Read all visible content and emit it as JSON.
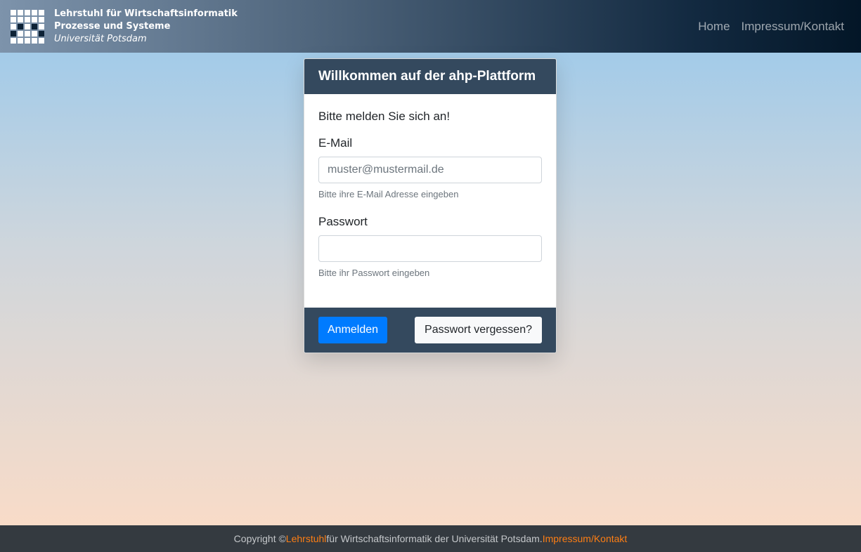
{
  "header": {
    "brand_line1": "Lehrstuhl für Wirtschaftsinformatik",
    "brand_line2": "Prozesse und Systeme",
    "brand_line3": "Universität Potsdam",
    "logo_icon": "chair-logo-grid-icon",
    "nav": [
      {
        "label": "Home"
      },
      {
        "label": "Impressum/Kontakt"
      }
    ]
  },
  "card": {
    "title": "Willkommen auf der ahp-Plattform",
    "intro": "Bitte melden Sie sich an!",
    "email": {
      "label": "E-Mail",
      "placeholder": "muster@mustermail.de",
      "value": "",
      "help": "Bitte ihre E-Mail Adresse eingeben"
    },
    "password": {
      "label": "Passwort",
      "value": "",
      "help": "Bitte ihr Passwort eingeben"
    },
    "login_label": "Anmelden",
    "forgot_label": "Passwort vergessen?"
  },
  "footer": {
    "prefix": "Copyright © ",
    "link1": "Lehrstuhl",
    "middle": " für Wirtschaftsinformatik der Universität Potsdam. ",
    "link2": "Impressum/Kontakt"
  },
  "colors": {
    "header_dark": "#031627",
    "card_header": "#34495e",
    "primary": "#007bff",
    "footer_bg": "#343a40",
    "footer_link": "#fd7e14"
  }
}
